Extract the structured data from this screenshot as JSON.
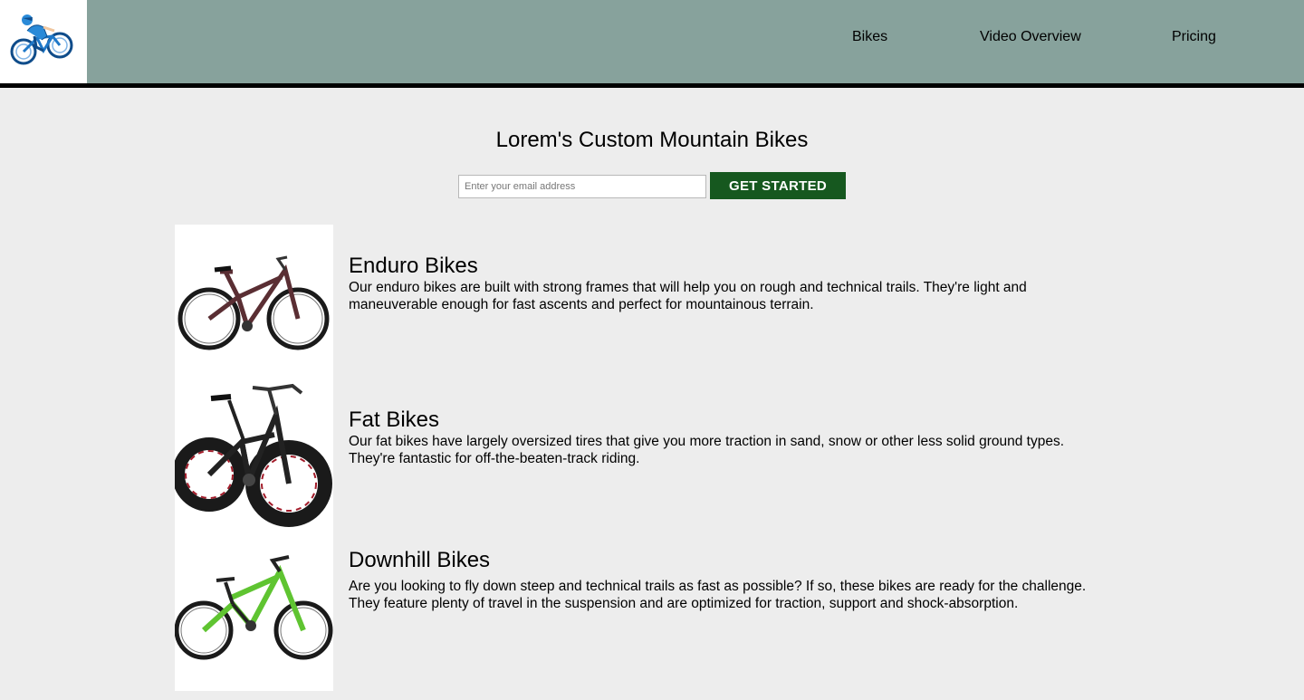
{
  "header": {
    "logo_icon": "cyclist-icon",
    "nav": [
      "Bikes",
      "Video Overview",
      "Pricing"
    ]
  },
  "hero": {
    "title": "Lorem's Custom Mountain Bikes",
    "email_placeholder": "Enter your email address",
    "email_value": "",
    "cta_label": "GET STARTED"
  },
  "products": [
    {
      "name": "Enduro Bikes",
      "description": "Our enduro bikes are built with strong frames that will help you on rough and technical trails. They're light and maneuverable enough for fast ascents and perfect for mountainous terrain.",
      "image_icon": "enduro-bike-icon"
    },
    {
      "name": "Fat Bikes",
      "description": "Our fat bikes have largely oversized tires that give you more traction in sand, snow or other less solid ground types. They're fantastic for off-the-beaten-track riding.",
      "image_icon": "fat-bike-icon"
    },
    {
      "name": "Downhill Bikes",
      "description": "Are you looking to fly down steep and technical trails as fast as possible? If so, these bikes are ready for the challenge. They feature plenty of travel in the suspension and are optimized for traction, support and shock-absorption.",
      "image_icon": "downhill-bike-icon"
    }
  ],
  "colors": {
    "header_bg": "#87a29c",
    "cta_bg": "#16581f",
    "page_bg": "#ededed",
    "enduro_frame": "#5a2e33",
    "downhill_accent": "#5fc431"
  }
}
